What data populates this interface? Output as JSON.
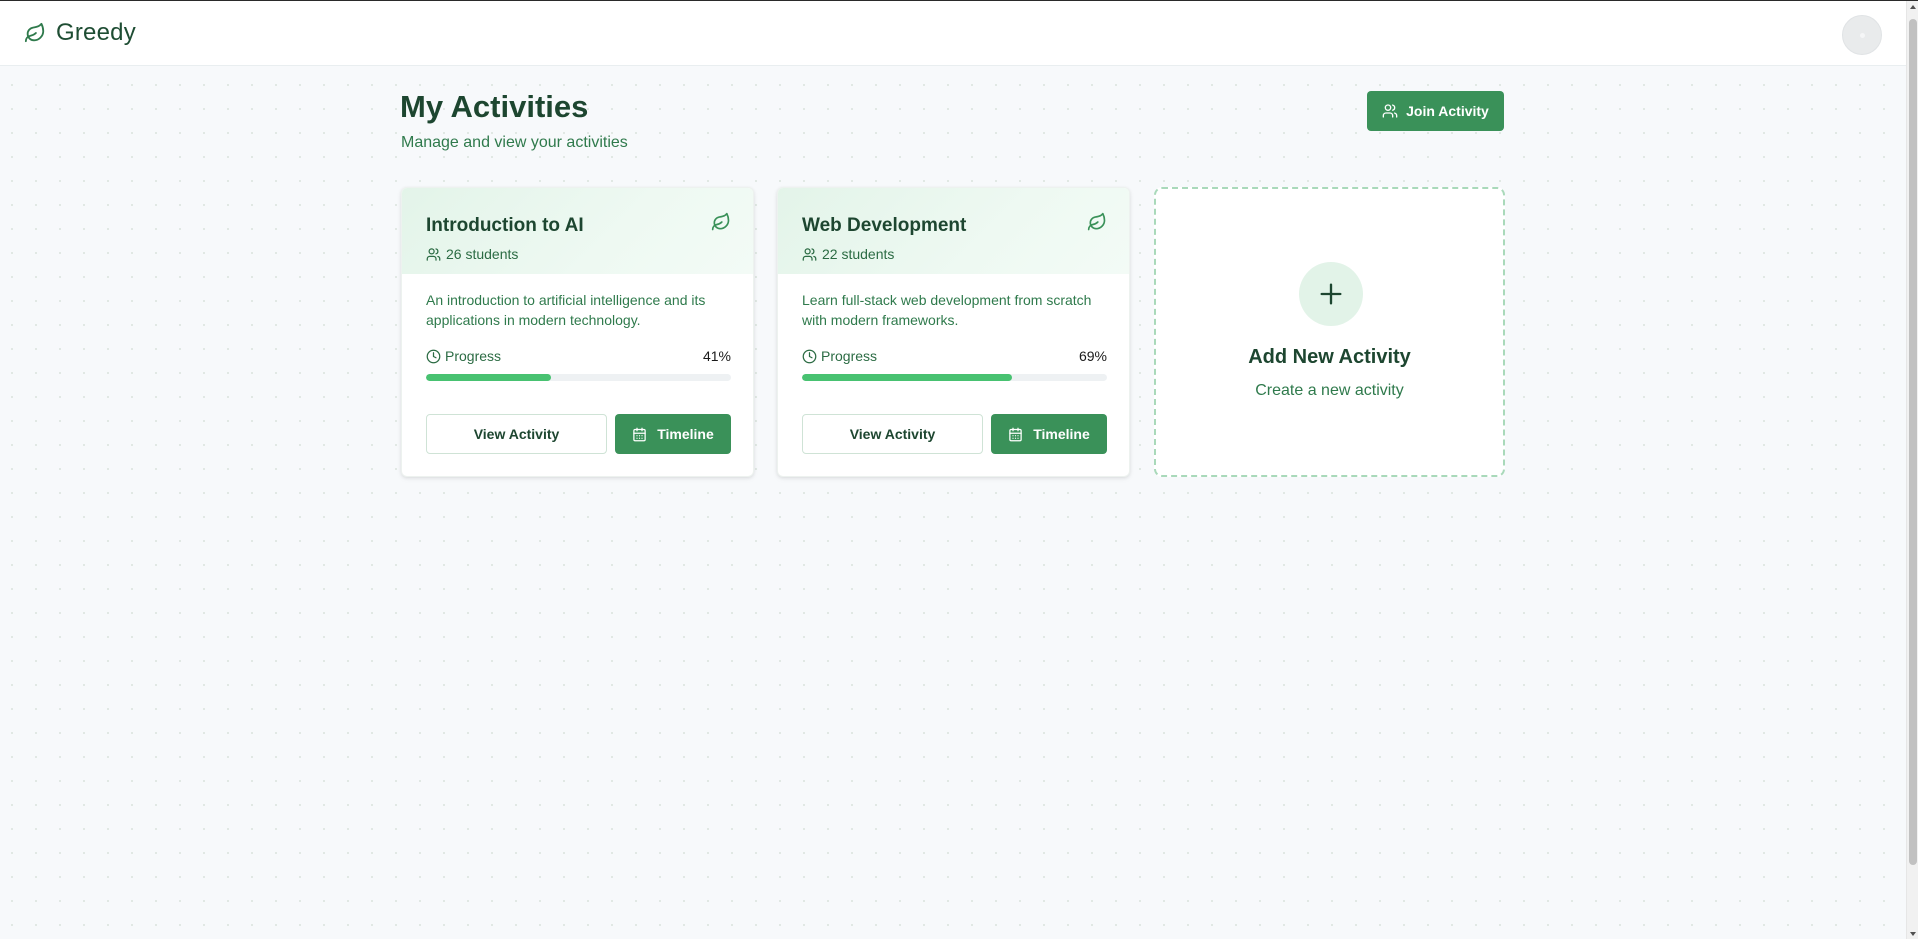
{
  "app": {
    "name": "Greedy",
    "brand_icon": "leaf-icon"
  },
  "header": {
    "avatar_icon": "user-avatar"
  },
  "page": {
    "title": "My Activities",
    "subtitle": "Manage and view your activities",
    "join_button_label": "Join Activity"
  },
  "activities": [
    {
      "title": "Introduction to AI",
      "students": "26 students",
      "description": "An introduction to artificial intelligence and its applications in modern technology.",
      "progress_label": "Progress",
      "progress_text": "41%",
      "progress": 0.41,
      "view_label": "View Activity",
      "timeline_label": "Timeline"
    },
    {
      "title": "Web Development",
      "students": "22 students",
      "description": "Learn full-stack web development from scratch with modern frameworks.",
      "progress_label": "Progress",
      "progress_text": "69%",
      "progress": 0.69,
      "view_label": "View Activity",
      "timeline_label": "Timeline"
    }
  ],
  "add_card": {
    "title": "Add New Activity",
    "subtitle": "Create a new activity"
  },
  "colors": {
    "primary": "#3a9159",
    "dark_green": "#1d4630",
    "progress_fill": "#48c271"
  }
}
